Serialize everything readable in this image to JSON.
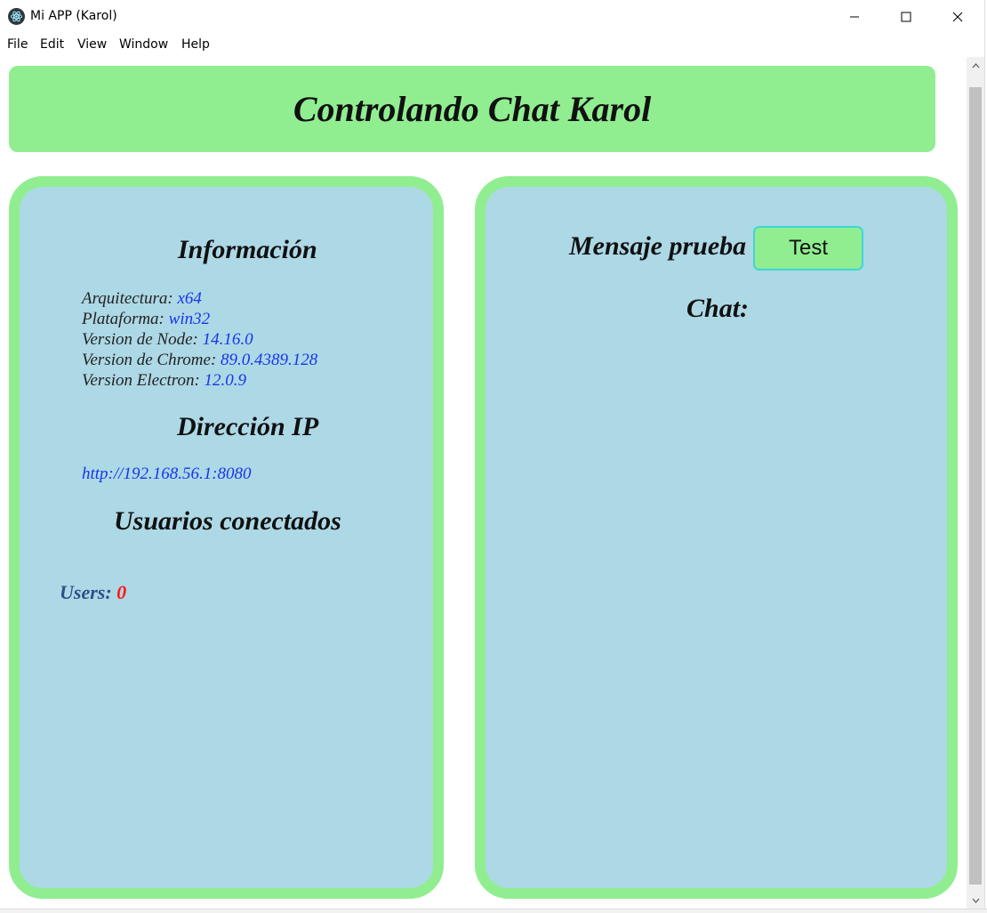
{
  "window": {
    "title": "Mi APP (Karol)",
    "app_icon": "electron-icon",
    "controls": [
      "minimize-icon",
      "maximize-icon",
      "close-icon"
    ]
  },
  "menu": [
    "File",
    "Edit",
    "View",
    "Window",
    "Help"
  ],
  "header": {
    "title": "Controlando Chat Karol"
  },
  "left_panel": {
    "info_title": "Información",
    "info_items": [
      {
        "label": "Arquitectura:",
        "value": "x64"
      },
      {
        "label": "Plataforma:",
        "value": "win32"
      },
      {
        "label": "Version de Node:",
        "value": "14.16.0"
      },
      {
        "label": "Version de Chrome:",
        "value": "89.0.4389.128"
      },
      {
        "label": "Version Electron:",
        "value": "12.0.9"
      }
    ],
    "ip_title": "Dirección IP",
    "ip_link": "http://192.168.56.1:8080",
    "users_title": "Usuarios conectados",
    "users_label": "Users:",
    "users_count": "0"
  },
  "right_panel": {
    "test_label": "Mensaje prueba",
    "test_button": "Test",
    "chat_title": "Chat:"
  },
  "colors": {
    "header_bg": "#90ee90",
    "panel_bg": "#add8e6",
    "panel_border": "#90ee90",
    "value_text": "#1a35e8",
    "users_count": "#ff1a1a"
  }
}
